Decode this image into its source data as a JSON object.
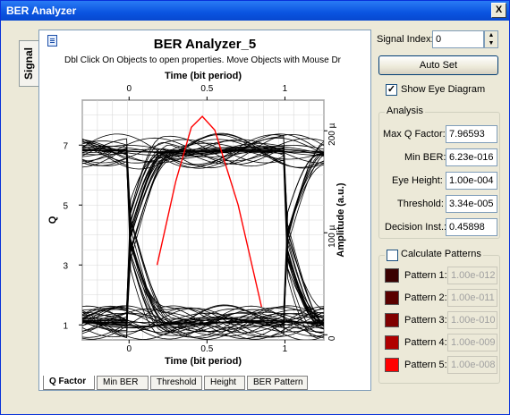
{
  "window": {
    "title": "BER Analyzer",
    "close_label": "X"
  },
  "side_tab": {
    "label": "Signal"
  },
  "plot": {
    "title": "BER Analyzer_5",
    "subtitle": "Dbl Click On Objects to open properties.  Move Objects with Mouse Dr",
    "xlabel_top": "Time (bit period)",
    "xlabel_bottom": "Time (bit period)",
    "ylabel_left": "Q",
    "ylabel_right": "Amplitude (a.u.)"
  },
  "chart_data": {
    "type": "line",
    "x_ticks": [
      "0",
      "0.5",
      "1"
    ],
    "xlim": [
      -0.3,
      1.25
    ],
    "y_left_ticks": [
      "1",
      "3",
      "5",
      "7"
    ],
    "y_left_lim": [
      0.5,
      8.5
    ],
    "y_right_ticks": [
      "0",
      "100 µ",
      "200 µ"
    ],
    "y_right_lim": [
      -5e-06,
      0.00023
    ],
    "grid": true,
    "series": [
      {
        "kind": "eye_traces",
        "color": "#000000",
        "amplitude_low": 1.2e-05,
        "amplitude_high": 0.00018
      },
      {
        "kind": "q_factor",
        "color": "#ff0000",
        "x": [
          0.18,
          0.3,
          0.4,
          0.47,
          0.55,
          0.7,
          0.85
        ],
        "y": [
          3.0,
          5.8,
          7.6,
          7.96,
          7.5,
          5.0,
          1.6
        ]
      }
    ]
  },
  "tabs": [
    "Q Factor",
    "Min BER",
    "Threshold",
    "Height",
    "BER Pattern"
  ],
  "controls": {
    "signal_index_label": "Signal Index:",
    "signal_index_value": "0",
    "auto_set_label": "Auto Set",
    "show_eye_label": "Show Eye Diagram",
    "show_eye_checked": "✓"
  },
  "analysis": {
    "title": "Analysis",
    "rows": [
      {
        "label": "Max Q Factor:",
        "value": "7.96593"
      },
      {
        "label": "Min BER:",
        "value": "6.23e-016"
      },
      {
        "label": "Eye Height:",
        "value": "1.00e-004"
      },
      {
        "label": "Threshold:",
        "value": "3.34e-005"
      },
      {
        "label": "Decision Inst.:",
        "value": "0.45898"
      }
    ]
  },
  "patterns": {
    "title": "Calculate Patterns",
    "rows": [
      {
        "label": "Pattern 1:",
        "value": "1.00e-012",
        "color": "#3a0000"
      },
      {
        "label": "Pattern 2:",
        "value": "1.00e-011",
        "color": "#5a0000"
      },
      {
        "label": "Pattern 3:",
        "value": "1.00e-010",
        "color": "#800000"
      },
      {
        "label": "Pattern 4:",
        "value": "1.00e-009",
        "color": "#b00000"
      },
      {
        "label": "Pattern 5:",
        "value": "1.00e-008",
        "color": "#ff0000"
      }
    ]
  }
}
